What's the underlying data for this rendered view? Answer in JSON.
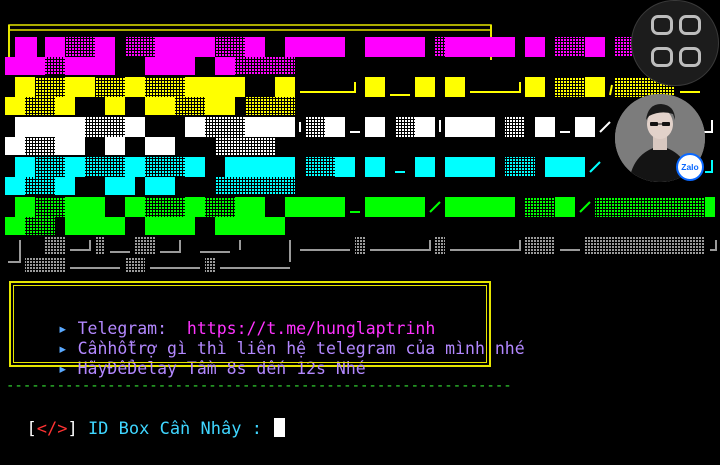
{
  "colors": {
    "background": "#000000",
    "banner_yellow": "#ffff00",
    "banner_magenta": "#ff00ff",
    "banner_white": "#ffffff",
    "banner_cyan": "#00ffff",
    "banner_green": "#00ff00",
    "banner_gray": "#9a9a9a",
    "info_border": "#e6e600",
    "info_text": "#b388ff",
    "telegram_url": "#ff33ff",
    "separator": "#33dd33",
    "prompt_text": "#3fd6ff"
  },
  "info": {
    "arrow": "▸",
    "line1_label": "Telegram:  ",
    "line1_url": "https://t.me/hunglaptrinh",
    "line2": "Cầnhỗtrợ gì thì liên hệ telegram của mình nhé",
    "line3": "HãyĐểDelay Tầm 8s đến 12s Nhé"
  },
  "separator": "------------------------------------------------------------",
  "prompt": {
    "open": "[",
    "tag": "</>",
    "close": "]",
    "label": " ID Box Cần Nhây : ",
    "value": ""
  },
  "overlay": {
    "assistive_touch_icon": "assistive-touch-icon",
    "chat_head_badge": "Zalo"
  }
}
